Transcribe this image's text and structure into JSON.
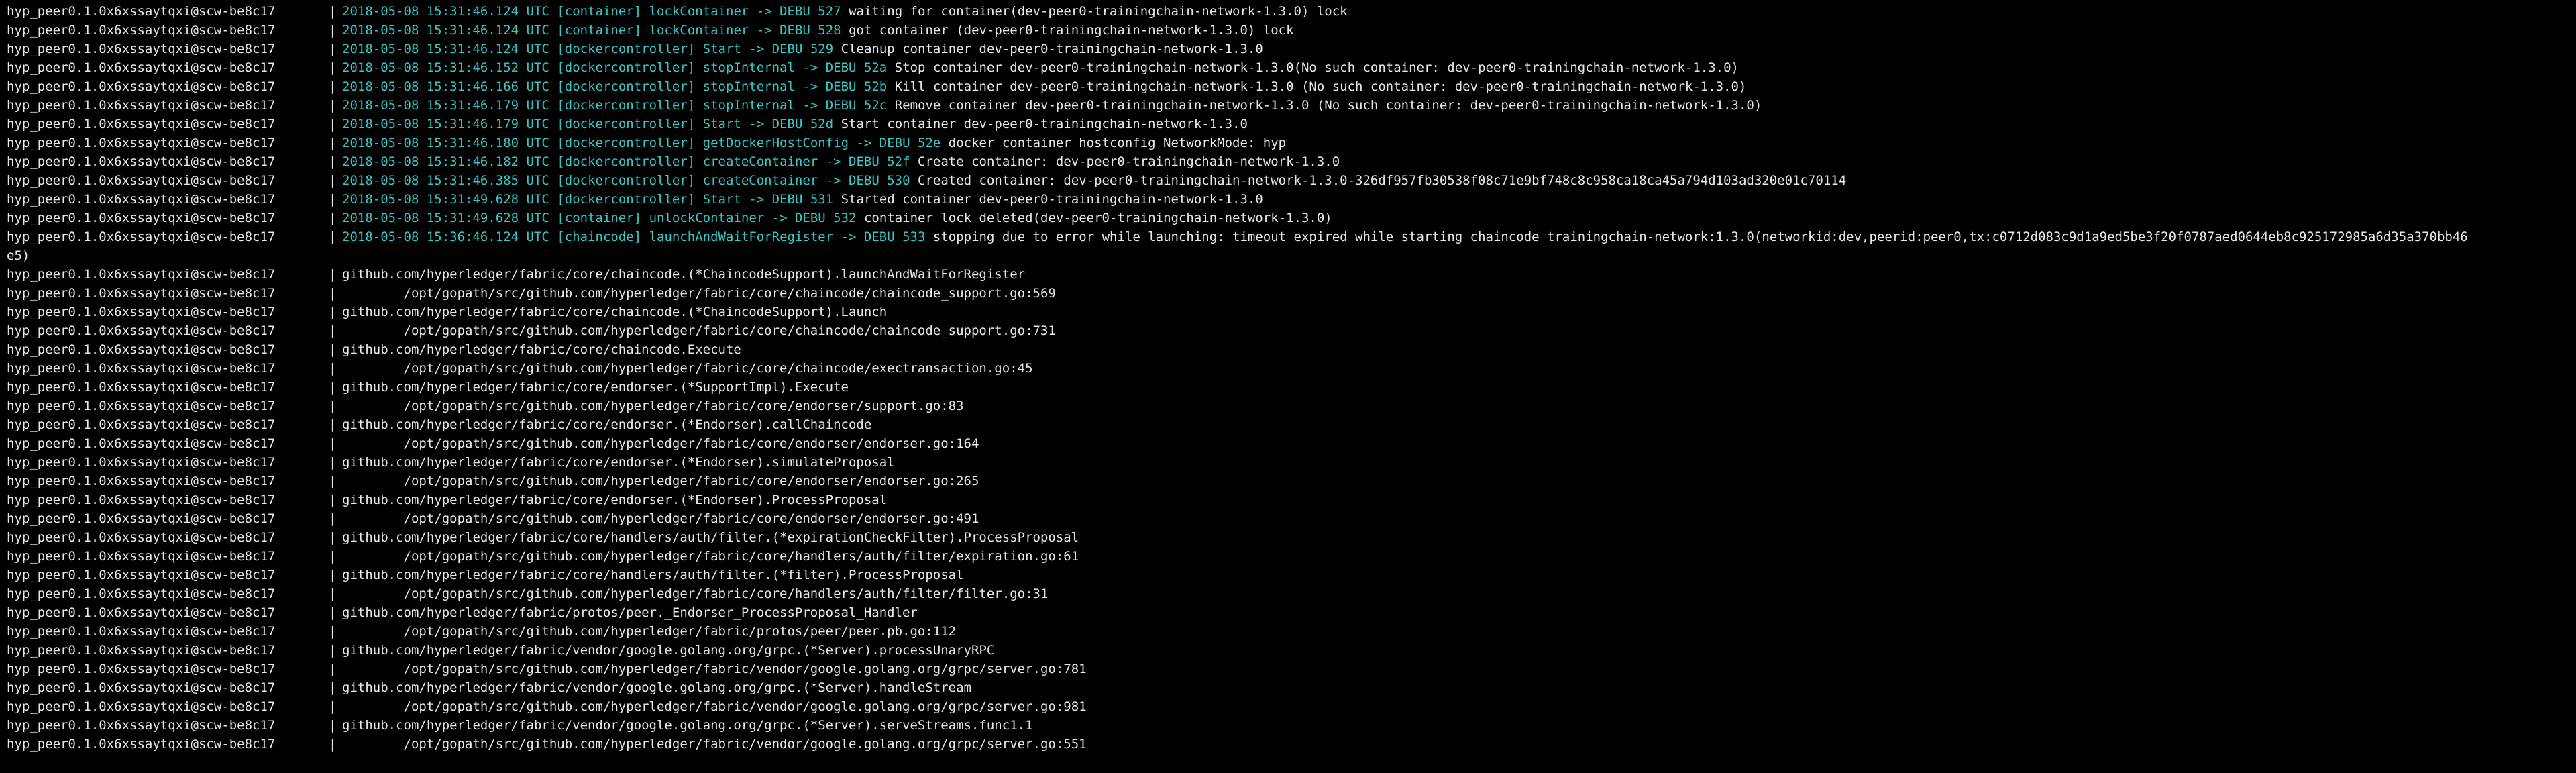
{
  "colors": {
    "background": "#000000",
    "text": "#e8e8e8",
    "accent": "#38c7c7"
  },
  "prefix": "hyp_peer0.1.0x6xssaytqxi@scw-be8c17",
  "separator": "|",
  "log_lines": [
    {
      "ts": "2018-05-08 15:31:46.124 UTC",
      "module": "[container]",
      "func": "lockContainer",
      "level": "-> DEBU 527",
      "msg": "waiting for container(dev-peer0-trainingchain-network-1.3.0) lock"
    },
    {
      "ts": "2018-05-08 15:31:46.124 UTC",
      "module": "[container]",
      "func": "lockContainer",
      "level": "-> DEBU 528",
      "msg": "got container (dev-peer0-trainingchain-network-1.3.0) lock"
    },
    {
      "ts": "2018-05-08 15:31:46.124 UTC",
      "module": "[dockercontroller]",
      "func": "Start",
      "level": "-> DEBU 529",
      "msg": "Cleanup container dev-peer0-trainingchain-network-1.3.0"
    },
    {
      "ts": "2018-05-08 15:31:46.152 UTC",
      "module": "[dockercontroller]",
      "func": "stopInternal",
      "level": "-> DEBU 52a",
      "msg": "Stop container dev-peer0-trainingchain-network-1.3.0(No such container: dev-peer0-trainingchain-network-1.3.0)"
    },
    {
      "ts": "2018-05-08 15:31:46.166 UTC",
      "module": "[dockercontroller]",
      "func": "stopInternal",
      "level": "-> DEBU 52b",
      "msg": "Kill container dev-peer0-trainingchain-network-1.3.0 (No such container: dev-peer0-trainingchain-network-1.3.0)"
    },
    {
      "ts": "2018-05-08 15:31:46.179 UTC",
      "module": "[dockercontroller]",
      "func": "stopInternal",
      "level": "-> DEBU 52c",
      "msg": "Remove container dev-peer0-trainingchain-network-1.3.0 (No such container: dev-peer0-trainingchain-network-1.3.0)"
    },
    {
      "ts": "2018-05-08 15:31:46.179 UTC",
      "module": "[dockercontroller]",
      "func": "Start",
      "level": "-> DEBU 52d",
      "msg": "Start container dev-peer0-trainingchain-network-1.3.0"
    },
    {
      "ts": "2018-05-08 15:31:46.180 UTC",
      "module": "[dockercontroller]",
      "func": "getDockerHostConfig",
      "level": "-> DEBU 52e",
      "msg": "docker container hostconfig NetworkMode: hyp"
    },
    {
      "ts": "2018-05-08 15:31:46.182 UTC",
      "module": "[dockercontroller]",
      "func": "createContainer",
      "level": "-> DEBU 52f",
      "msg": "Create container: dev-peer0-trainingchain-network-1.3.0"
    },
    {
      "ts": "2018-05-08 15:31:46.385 UTC",
      "module": "[dockercontroller]",
      "func": "createContainer",
      "level": "-> DEBU 530",
      "msg": "Created container: dev-peer0-trainingchain-network-1.3.0-326df957fb30538f08c71e9bf748c8c958ca18ca45a794d103ad320e01c70114"
    },
    {
      "ts": "2018-05-08 15:31:49.628 UTC",
      "module": "[dockercontroller]",
      "func": "Start",
      "level": "-> DEBU 531",
      "msg": "Started container dev-peer0-trainingchain-network-1.3.0"
    },
    {
      "ts": "2018-05-08 15:31:49.628 UTC",
      "module": "[container]",
      "func": "unlockContainer",
      "level": "-> DEBU 532",
      "msg": "container lock deleted(dev-peer0-trainingchain-network-1.3.0)"
    },
    {
      "ts": "2018-05-08 15:36:46.124 UTC",
      "module": "[chaincode]",
      "func": "launchAndWaitForRegister",
      "level": "-> DEBU 533",
      "msg": "stopping due to error while launching: timeout expired while starting chaincode trainingchain-network:1.3.0(networkid:dev,peerid:peer0,tx:c0712d083c9d1a9ed5be3f20f0787aed0644eb8c925172985a6d35a370bb46",
      "wrap": "e5)"
    }
  ],
  "stack_lines": [
    "github.com/hyperledger/fabric/core/chaincode.(*ChaincodeSupport).launchAndWaitForRegister",
    "        /opt/gopath/src/github.com/hyperledger/fabric/core/chaincode/chaincode_support.go:569",
    "github.com/hyperledger/fabric/core/chaincode.(*ChaincodeSupport).Launch",
    "        /opt/gopath/src/github.com/hyperledger/fabric/core/chaincode/chaincode_support.go:731",
    "github.com/hyperledger/fabric/core/chaincode.Execute",
    "        /opt/gopath/src/github.com/hyperledger/fabric/core/chaincode/exectransaction.go:45",
    "github.com/hyperledger/fabric/core/endorser.(*SupportImpl).Execute",
    "        /opt/gopath/src/github.com/hyperledger/fabric/core/endorser/support.go:83",
    "github.com/hyperledger/fabric/core/endorser.(*Endorser).callChaincode",
    "        /opt/gopath/src/github.com/hyperledger/fabric/core/endorser/endorser.go:164",
    "github.com/hyperledger/fabric/core/endorser.(*Endorser).simulateProposal",
    "        /opt/gopath/src/github.com/hyperledger/fabric/core/endorser/endorser.go:265",
    "github.com/hyperledger/fabric/core/endorser.(*Endorser).ProcessProposal",
    "        /opt/gopath/src/github.com/hyperledger/fabric/core/endorser/endorser.go:491",
    "github.com/hyperledger/fabric/core/handlers/auth/filter.(*expirationCheckFilter).ProcessProposal",
    "        /opt/gopath/src/github.com/hyperledger/fabric/core/handlers/auth/filter/expiration.go:61",
    "github.com/hyperledger/fabric/core/handlers/auth/filter.(*filter).ProcessProposal",
    "        /opt/gopath/src/github.com/hyperledger/fabric/core/handlers/auth/filter/filter.go:31",
    "github.com/hyperledger/fabric/protos/peer._Endorser_ProcessProposal_Handler",
    "        /opt/gopath/src/github.com/hyperledger/fabric/protos/peer/peer.pb.go:112",
    "github.com/hyperledger/fabric/vendor/google.golang.org/grpc.(*Server).processUnaryRPC",
    "        /opt/gopath/src/github.com/hyperledger/fabric/vendor/google.golang.org/grpc/server.go:781",
    "github.com/hyperledger/fabric/vendor/google.golang.org/grpc.(*Server).handleStream",
    "        /opt/gopath/src/github.com/hyperledger/fabric/vendor/google.golang.org/grpc/server.go:981",
    "github.com/hyperledger/fabric/vendor/google.golang.org/grpc.(*Server).serveStreams.func1.1",
    "        /opt/gopath/src/github.com/hyperledger/fabric/vendor/google.golang.org/grpc/server.go:551"
  ]
}
